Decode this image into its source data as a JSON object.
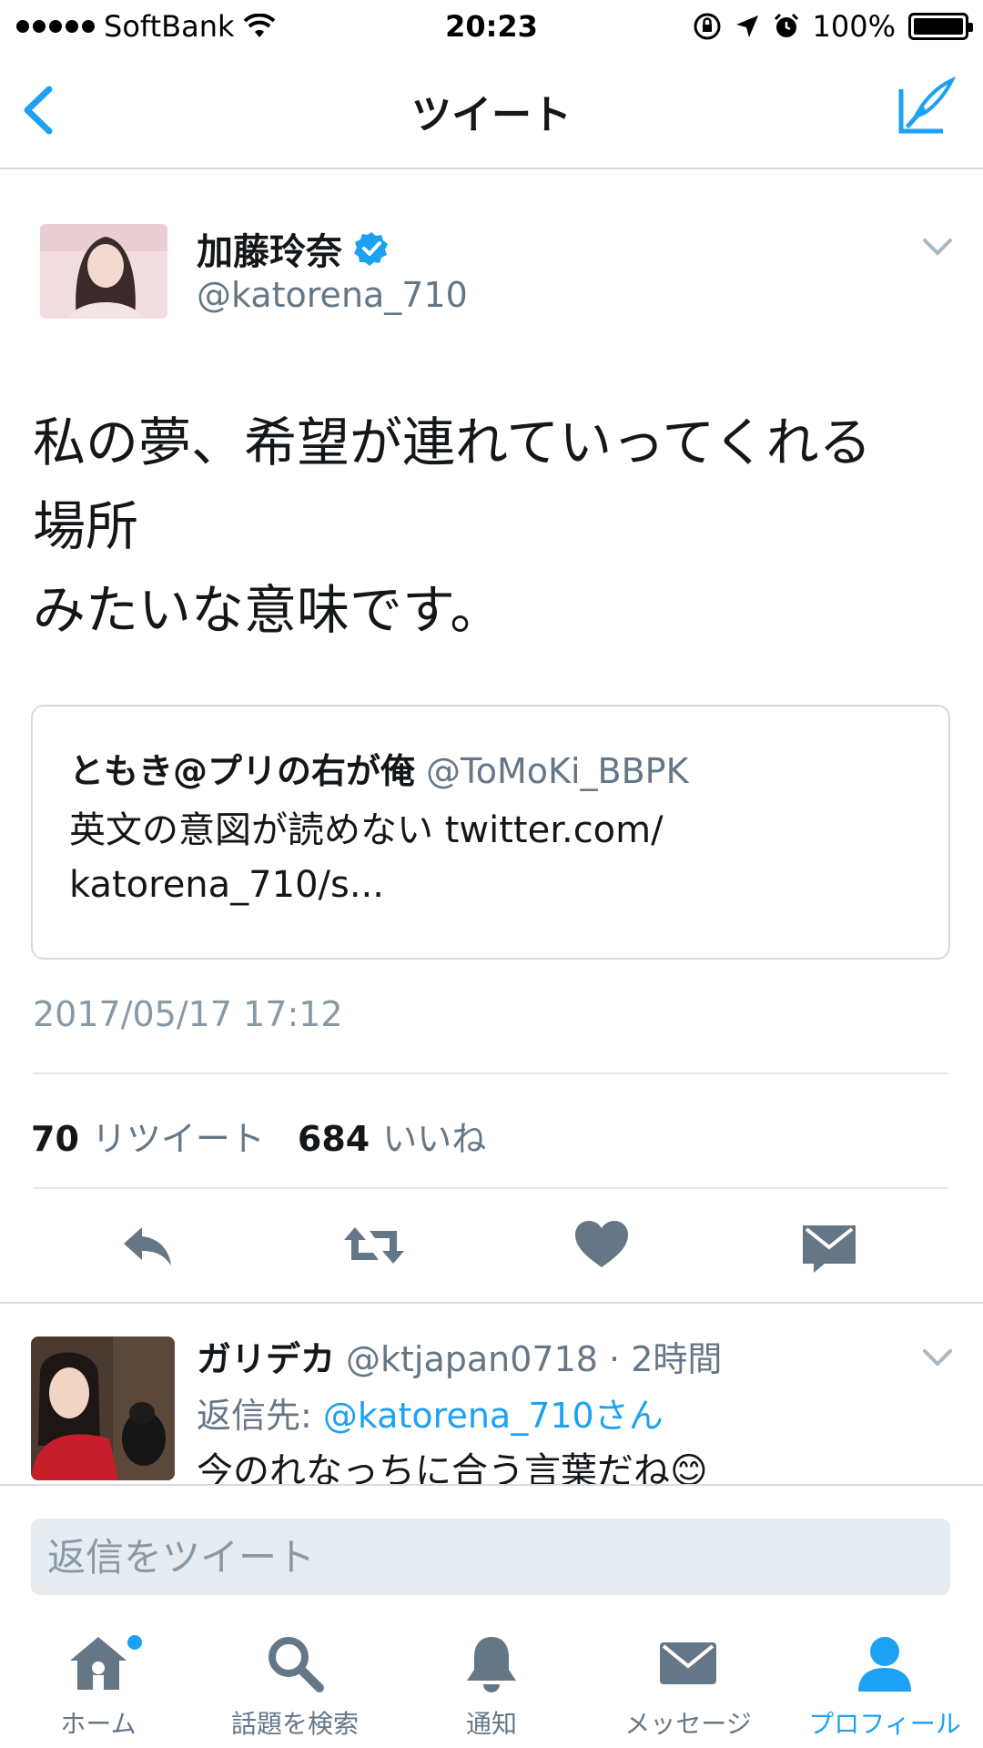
{
  "status_bar": {
    "carrier": "SoftBank",
    "time": "20:23",
    "battery": "100%"
  },
  "nav": {
    "title": "ツイート"
  },
  "tweet": {
    "author_name": "加藤玲奈",
    "author_handle": "@katorena_710",
    "text_lines": [
      "私の夢、希望が連れていってくれる",
      "場所",
      "みたいな意味です。"
    ],
    "quote": {
      "name": "ともき@プリの右が俺",
      "handle": "@ToMoKi_BBPK",
      "text_lines": [
        "英文の意図が読めない twitter.com/",
        "katorena_710/s..."
      ]
    },
    "timestamp": "2017/05/17 17:12",
    "retweet_count": "70",
    "retweet_label": "リツイート",
    "like_count": "684",
    "like_label": "いいね"
  },
  "reply": {
    "name": "ガリデカ",
    "meta": "@ktjapan0718 · 2時間",
    "reply_to_prefix": "返信先: ",
    "reply_to_handle": "@katorena_710さん",
    "text": "今のれなっちに合う言葉だね😊"
  },
  "reply_bar": {
    "placeholder": "返信をツイート"
  },
  "tabs": [
    {
      "label": "ホーム",
      "icon": "home-icon"
    },
    {
      "label": "話題を検索",
      "icon": "search-icon"
    },
    {
      "label": "通知",
      "icon": "bell-icon"
    },
    {
      "label": "メッセージ",
      "icon": "envelope-icon"
    },
    {
      "label": "プロフィール",
      "icon": "person-icon"
    }
  ],
  "colors": {
    "accent": "#1da1f2",
    "gray": "#657786",
    "text": "#14171a"
  }
}
